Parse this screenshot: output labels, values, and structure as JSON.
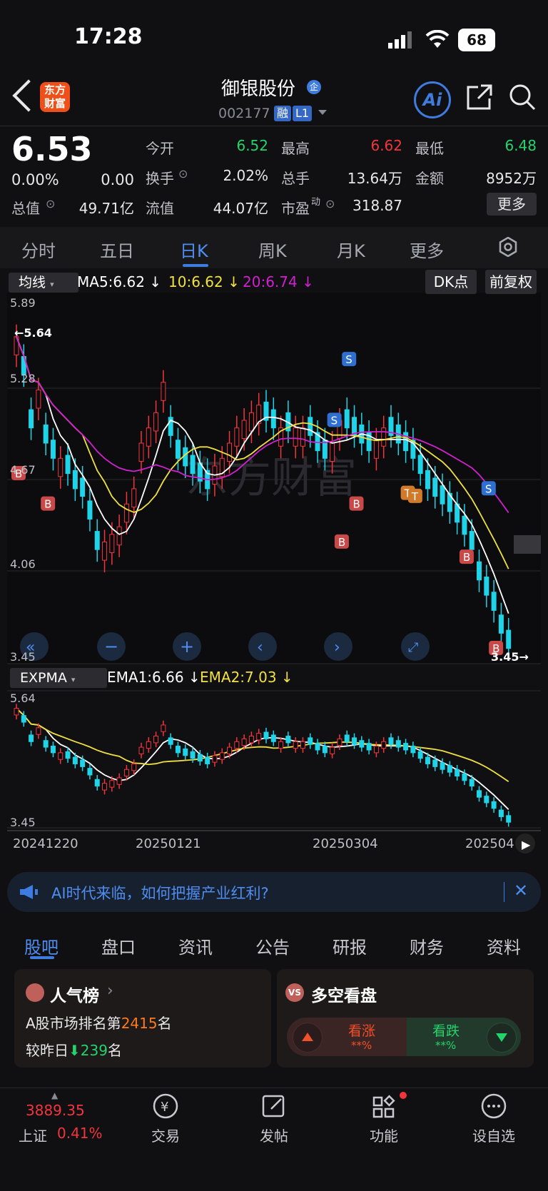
{
  "status_bar": {
    "time": "17:28",
    "battery": "68"
  },
  "header": {
    "logo_line1": "东方",
    "logo_line2": "财富",
    "stock_name": "御银股份",
    "qi_badge": "企",
    "stock_code": "002177",
    "tag_margin": "融",
    "tag_level": "L1",
    "ai_label": "Ai"
  },
  "quote": {
    "price": "6.53",
    "change_pct": "0.00%",
    "change_amt": "0.00",
    "open_label": "今开",
    "open_val": "6.52",
    "high_label": "最高",
    "high_val": "6.62",
    "low_label": "最低",
    "low_val": "6.48",
    "turnover_label": "换手",
    "turnover_val": "2.02%",
    "volume_label": "总手",
    "volume_val": "13.64万",
    "amount_label": "金额",
    "amount_val": "8952万",
    "mktcap_label": "总值",
    "mktcap_val": "49.71亿",
    "float_label": "流值",
    "float_val": "44.07亿",
    "pe_label": "市盈",
    "pe_sup": "动",
    "pe_val": "318.87",
    "more_label": "更多"
  },
  "period_tabs": [
    "分时",
    "五日",
    "日K",
    "周K",
    "月K",
    "更多"
  ],
  "ma_bar": {
    "dropdown": "均线",
    "ma5": "MA5:6.62",
    "ma10": "10:6.62",
    "ma20": "20:6.74",
    "dk_label": "DK点",
    "adjust_label": "前复权"
  },
  "main_chart": {
    "y_ticks": [
      "5.89",
      "5.28",
      "4.67",
      "4.06",
      "3.45"
    ],
    "high_marker": "←5.64",
    "low_marker": "3.45→",
    "watermark": "东方财富"
  },
  "expma_bar": {
    "dropdown": "EXPMA",
    "ema1": "EMA1:6.66",
    "ema2": "EMA2:7.03",
    "y_top": "5.64",
    "y_bottom": "3.45"
  },
  "x_axis": [
    "20241220",
    "20250121",
    "20250304",
    "202504"
  ],
  "banner": {
    "text": "AI时代来临，如何把握产业红利?"
  },
  "sub_tabs": [
    "股吧",
    "盘口",
    "资讯",
    "公告",
    "研报",
    "财务",
    "资料"
  ],
  "popularity_card": {
    "title": "人气榜",
    "rank_prefix": "A股市场排名第",
    "rank_value": "2415",
    "rank_suffix": "名",
    "change_prefix": "较昨日",
    "change_value": "239",
    "change_suffix": "名"
  },
  "sentiment_card": {
    "title": "多空看盘",
    "bull_label": "看涨",
    "bull_value": "**%",
    "bear_label": "看跌",
    "bear_value": "**%"
  },
  "bottom_nav": {
    "index_value": "3889.35",
    "index_name": "上证",
    "index_change": "0.41%",
    "items": [
      "交易",
      "发帖",
      "功能",
      "设自选"
    ]
  },
  "chart_data": {
    "type": "candlestick",
    "ylim": [
      3.45,
      5.89
    ],
    "ma_lines": [
      "MA5",
      "MA10",
      "MA20"
    ],
    "signals": [
      "B",
      "S",
      "T"
    ],
    "colors": {
      "up": "#f2353d",
      "down": "#1fd4e8",
      "ma5": "#ffffff",
      "ma10": "#f0e040",
      "ma20": "#d020d0"
    }
  }
}
